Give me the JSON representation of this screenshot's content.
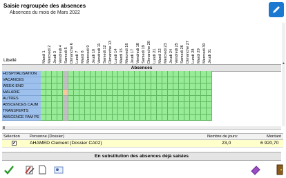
{
  "header": {
    "title": "Saisie regroupée des absences",
    "subtitle": "Absences du mois de Mars 2022"
  },
  "dates": [
    "Mardi 1",
    "Mercredi 2",
    "Jeudi 3",
    "Vendredi 4",
    "Samedi 5",
    "Dimanche 6",
    "Lundi 7",
    "Mardi 8",
    "Mercredi 9",
    "Jeudi 10",
    "Vendredi 11",
    "Samedi 12",
    "Dimanche 13",
    "Lundi 14",
    "Mardi 15",
    "Mercredi 16",
    "Jeudi 17",
    "Vendredi 18",
    "Samedi 19",
    "Dimanche 20",
    "Lundi 21",
    "Mardi 22",
    "Mercredi 23",
    "Jeudi 24",
    "Vendredi 25",
    "Samedi 26",
    "Dimanche 27",
    "Lundi 28",
    "Mardi 29",
    "Mercredi 30",
    "Jeudi 31"
  ],
  "grid": {
    "libelle_label": "Libellé",
    "section_title": "Absences",
    "rows": [
      "HOSPITALISATION",
      "VACANCES",
      "WEEK-END",
      "MALADIE",
      "AUTRES",
      "ABSCENCES CAJM",
      "TRANSFERTS",
      "ABSCENCE FAM PE"
    ]
  },
  "selection": {
    "headers": {
      "selection": "Sélection",
      "person": "Personne (Dossier)",
      "days": "Nombre de jours:",
      "amount": "Montant"
    },
    "rows": [
      {
        "checked": "✔",
        "person": "AHAMED Clement (Dossier CA02)",
        "days": "23,0",
        "amount": "6 920,70"
      }
    ]
  },
  "substitution": {
    "title": "En substitution des absences déjà saisies"
  },
  "colors": {
    "row_label": "#9dc0ec",
    "cell": "#98ec98",
    "mark": "#f8c79c",
    "blank": "#c0c0c0",
    "selection_row": "#ffffcc"
  },
  "toolbar": {
    "icons": [
      "checkmark-icon",
      "edit-tools-icon",
      "page-icon",
      "card-icon",
      "eraser-icon",
      "exit-door-icon"
    ]
  }
}
